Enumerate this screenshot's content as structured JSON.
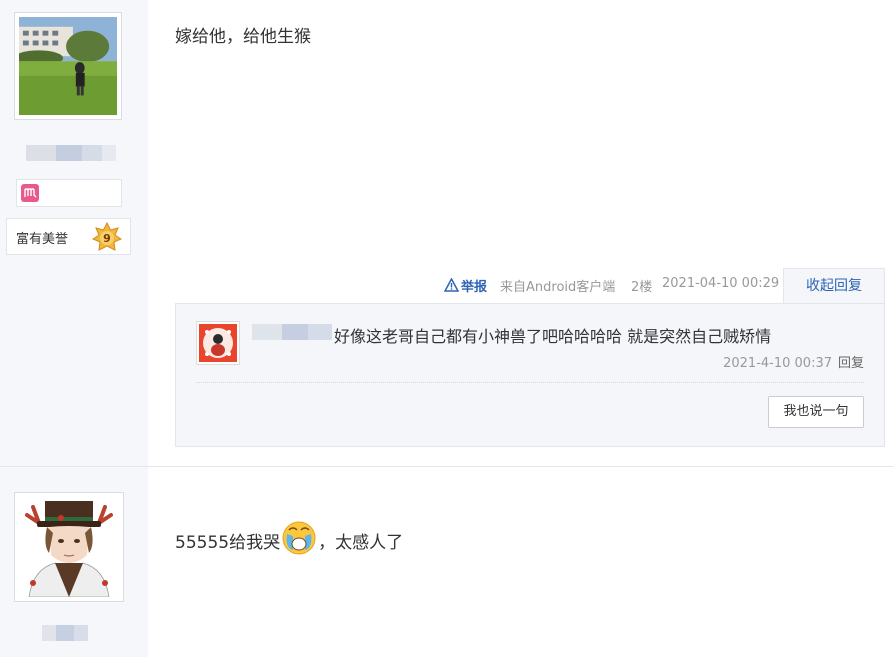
{
  "post1": {
    "content": "嫁给他，给他生猴",
    "honor_label": "富有美誉",
    "level": "9",
    "meta": {
      "report": "举报",
      "source": "来自Android客户端",
      "floor": "2楼",
      "time": "2021-04-10 00:29"
    },
    "collapse_label": "收起回复",
    "reply": {
      "text": "好像这老哥自己都有小神兽了吧哈哈哈哈 就是突然自己贼矫情",
      "time": "2021-4-10 00:37",
      "reply_label": "回复",
      "say_button": "我也说一句"
    }
  },
  "post2": {
    "content_prefix": "55555给我哭",
    "content_suffix": "，太感人了"
  },
  "colors": {
    "link_blue": "#2d64b3",
    "sidebar_bg": "#f5f7fa",
    "meta_gray": "#999999"
  },
  "icons": [
    "warning-icon",
    "level-badge-icon",
    "crying-emoji-icon",
    "member-icon"
  ]
}
